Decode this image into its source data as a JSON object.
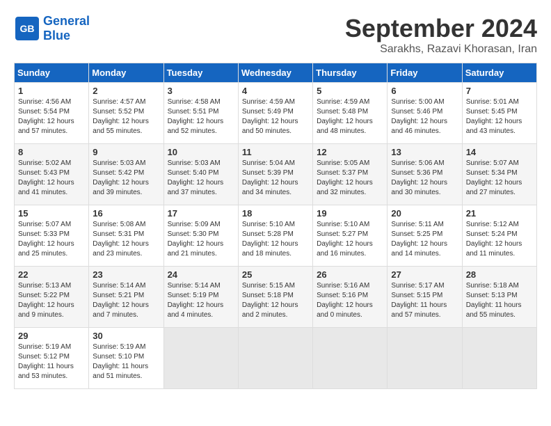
{
  "header": {
    "logo_line1": "General",
    "logo_line2": "Blue",
    "month": "September 2024",
    "location": "Sarakhs, Razavi Khorasan, Iran"
  },
  "columns": [
    "Sunday",
    "Monday",
    "Tuesday",
    "Wednesday",
    "Thursday",
    "Friday",
    "Saturday"
  ],
  "weeks": [
    [
      {
        "day": "1",
        "sunrise": "4:56 AM",
        "sunset": "5:54 PM",
        "daylight": "12 hours and 57 minutes."
      },
      {
        "day": "2",
        "sunrise": "4:57 AM",
        "sunset": "5:52 PM",
        "daylight": "12 hours and 55 minutes."
      },
      {
        "day": "3",
        "sunrise": "4:58 AM",
        "sunset": "5:51 PM",
        "daylight": "12 hours and 52 minutes."
      },
      {
        "day": "4",
        "sunrise": "4:59 AM",
        "sunset": "5:49 PM",
        "daylight": "12 hours and 50 minutes."
      },
      {
        "day": "5",
        "sunrise": "4:59 AM",
        "sunset": "5:48 PM",
        "daylight": "12 hours and 48 minutes."
      },
      {
        "day": "6",
        "sunrise": "5:00 AM",
        "sunset": "5:46 PM",
        "daylight": "12 hours and 46 minutes."
      },
      {
        "day": "7",
        "sunrise": "5:01 AM",
        "sunset": "5:45 PM",
        "daylight": "12 hours and 43 minutes."
      }
    ],
    [
      {
        "day": "8",
        "sunrise": "5:02 AM",
        "sunset": "5:43 PM",
        "daylight": "12 hours and 41 minutes."
      },
      {
        "day": "9",
        "sunrise": "5:03 AM",
        "sunset": "5:42 PM",
        "daylight": "12 hours and 39 minutes."
      },
      {
        "day": "10",
        "sunrise": "5:03 AM",
        "sunset": "5:40 PM",
        "daylight": "12 hours and 37 minutes."
      },
      {
        "day": "11",
        "sunrise": "5:04 AM",
        "sunset": "5:39 PM",
        "daylight": "12 hours and 34 minutes."
      },
      {
        "day": "12",
        "sunrise": "5:05 AM",
        "sunset": "5:37 PM",
        "daylight": "12 hours and 32 minutes."
      },
      {
        "day": "13",
        "sunrise": "5:06 AM",
        "sunset": "5:36 PM",
        "daylight": "12 hours and 30 minutes."
      },
      {
        "day": "14",
        "sunrise": "5:07 AM",
        "sunset": "5:34 PM",
        "daylight": "12 hours and 27 minutes."
      }
    ],
    [
      {
        "day": "15",
        "sunrise": "5:07 AM",
        "sunset": "5:33 PM",
        "daylight": "12 hours and 25 minutes."
      },
      {
        "day": "16",
        "sunrise": "5:08 AM",
        "sunset": "5:31 PM",
        "daylight": "12 hours and 23 minutes."
      },
      {
        "day": "17",
        "sunrise": "5:09 AM",
        "sunset": "5:30 PM",
        "daylight": "12 hours and 21 minutes."
      },
      {
        "day": "18",
        "sunrise": "5:10 AM",
        "sunset": "5:28 PM",
        "daylight": "12 hours and 18 minutes."
      },
      {
        "day": "19",
        "sunrise": "5:10 AM",
        "sunset": "5:27 PM",
        "daylight": "12 hours and 16 minutes."
      },
      {
        "day": "20",
        "sunrise": "5:11 AM",
        "sunset": "5:25 PM",
        "daylight": "12 hours and 14 minutes."
      },
      {
        "day": "21",
        "sunrise": "5:12 AM",
        "sunset": "5:24 PM",
        "daylight": "12 hours and 11 minutes."
      }
    ],
    [
      {
        "day": "22",
        "sunrise": "5:13 AM",
        "sunset": "5:22 PM",
        "daylight": "12 hours and 9 minutes."
      },
      {
        "day": "23",
        "sunrise": "5:14 AM",
        "sunset": "5:21 PM",
        "daylight": "12 hours and 7 minutes."
      },
      {
        "day": "24",
        "sunrise": "5:14 AM",
        "sunset": "5:19 PM",
        "daylight": "12 hours and 4 minutes."
      },
      {
        "day": "25",
        "sunrise": "5:15 AM",
        "sunset": "5:18 PM",
        "daylight": "12 hours and 2 minutes."
      },
      {
        "day": "26",
        "sunrise": "5:16 AM",
        "sunset": "5:16 PM",
        "daylight": "12 hours and 0 minutes."
      },
      {
        "day": "27",
        "sunrise": "5:17 AM",
        "sunset": "5:15 PM",
        "daylight": "11 hours and 57 minutes."
      },
      {
        "day": "28",
        "sunrise": "5:18 AM",
        "sunset": "5:13 PM",
        "daylight": "11 hours and 55 minutes."
      }
    ],
    [
      {
        "day": "29",
        "sunrise": "5:19 AM",
        "sunset": "5:12 PM",
        "daylight": "11 hours and 53 minutes."
      },
      {
        "day": "30",
        "sunrise": "5:19 AM",
        "sunset": "5:10 PM",
        "daylight": "11 hours and 51 minutes."
      },
      null,
      null,
      null,
      null,
      null
    ]
  ]
}
